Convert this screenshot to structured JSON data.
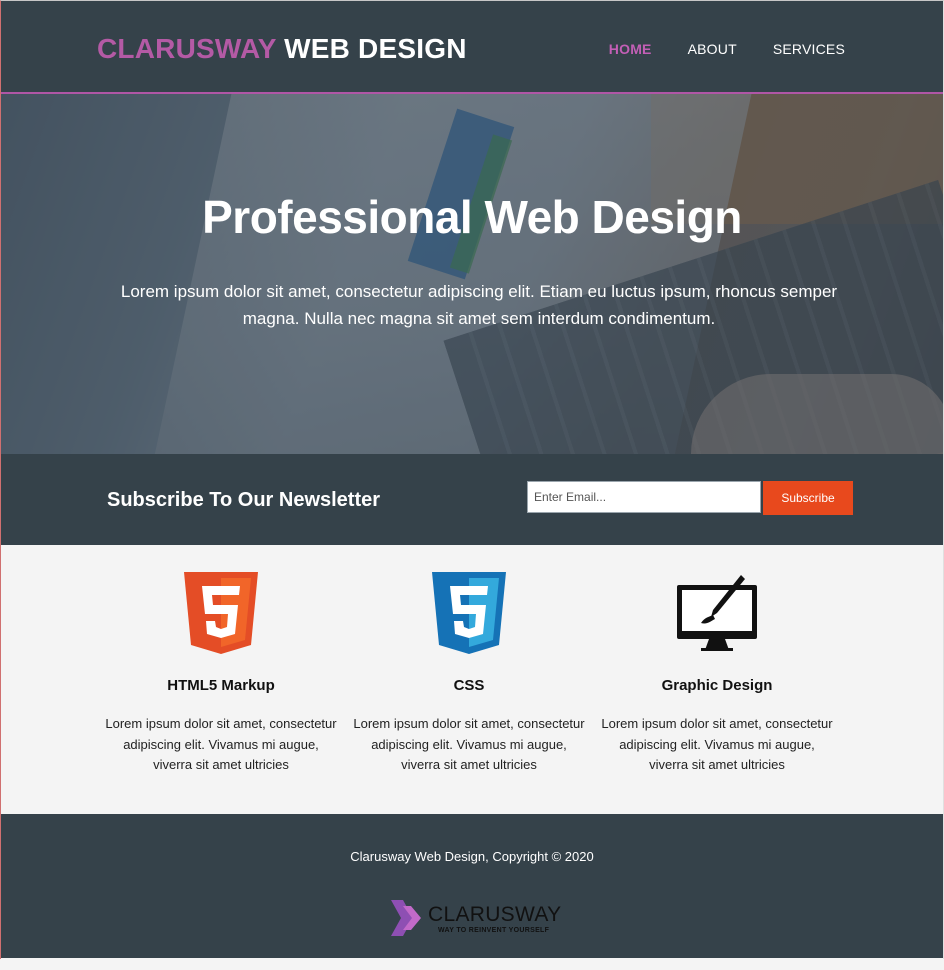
{
  "header": {
    "brand_highlight": "CLARUSWAY",
    "brand_rest": "WEB DESIGN",
    "nav": [
      {
        "label": "HOME",
        "active": true
      },
      {
        "label": "ABOUT",
        "active": false
      },
      {
        "label": "SERVICES",
        "active": false
      }
    ]
  },
  "hero": {
    "title": "Professional Web Design",
    "text": "Lorem ipsum dolor sit amet, consectetur adipiscing elit. Etiam eu luctus ipsum, rhoncus semper magna. Nulla nec magna sit amet sem interdum condimentum."
  },
  "newsletter": {
    "heading": "Subscribe To Our Newsletter",
    "email_placeholder": "Enter Email...",
    "email_value": "",
    "button_label": "Subscribe"
  },
  "boxes": [
    {
      "icon": "html5-icon",
      "title": "HTML5 Markup",
      "text": "Lorem ipsum dolor sit amet, consectetur adipiscing elit. Vivamus mi augue, viverra sit amet ultricies"
    },
    {
      "icon": "css3-icon",
      "title": "CSS",
      "text": "Lorem ipsum dolor sit amet, consectetur adipiscing elit. Vivamus mi augue, viverra sit amet ultricies"
    },
    {
      "icon": "graphic-design-icon",
      "title": "Graphic Design",
      "text": "Lorem ipsum dolor sit amet, consectetur adipiscing elit. Vivamus mi augue, viverra sit amet ultricies"
    }
  ],
  "footer": {
    "copyright": "Clarusway Web Design, Copyright © 2020",
    "logo_name": "CLARUSWAY",
    "logo_tagline": "WAY TO REINVENT YOURSELF"
  },
  "colors": {
    "header_bg": "#35424a",
    "brand_accent": "#b45aa5",
    "button": "#e8491d",
    "content_bg": "#f4f4f4"
  }
}
